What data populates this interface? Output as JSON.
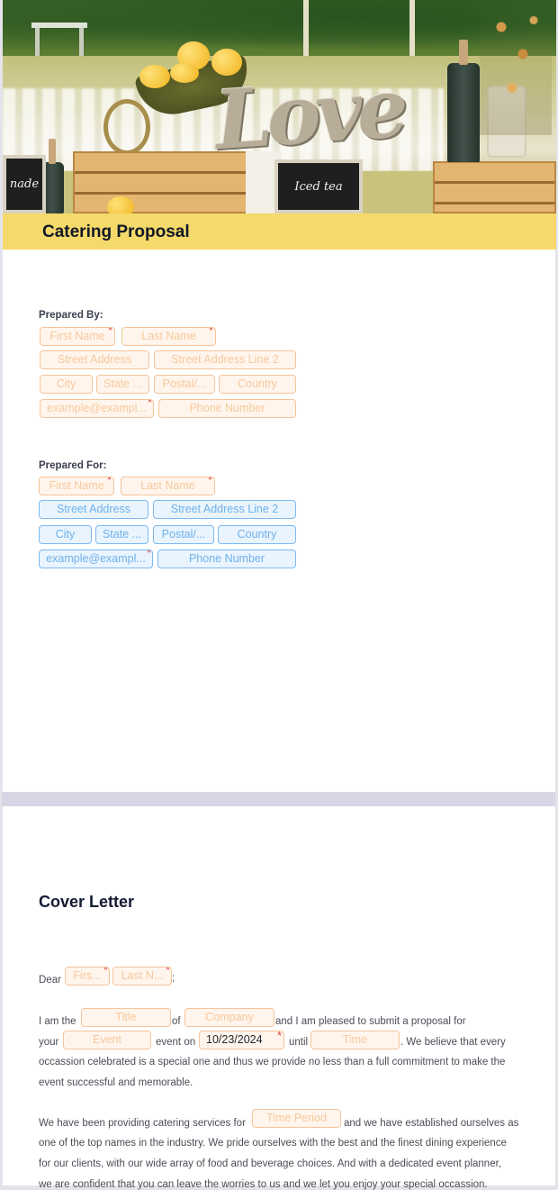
{
  "document": {
    "title": "Catering Proposal",
    "theme_color": "#f5d96a"
  },
  "hero": {
    "chalkboard_left": "nade",
    "chalkboard_center": "Iced tea",
    "sign": "Love"
  },
  "prepared_by": {
    "label": "Prepared By:",
    "first_name": {
      "placeholder": "First Name",
      "required": true
    },
    "last_name": {
      "placeholder": "Last Name",
      "required": true
    },
    "street_address": {
      "placeholder": "Street Address"
    },
    "street_address_2": {
      "placeholder": "Street Address Line 2"
    },
    "city": {
      "placeholder": "City"
    },
    "state": {
      "placeholder": "State ..."
    },
    "postal": {
      "placeholder": "Postal/..."
    },
    "country": {
      "placeholder": "Country"
    },
    "email": {
      "placeholder": "example@exampl...",
      "required": true
    },
    "phone": {
      "placeholder": "Phone Number"
    }
  },
  "prepared_for": {
    "label": "Prepared For:",
    "first_name": {
      "placeholder": "First Name",
      "required": true
    },
    "last_name": {
      "placeholder": "Last Name",
      "required": true
    },
    "street_address": {
      "placeholder": "Street Address"
    },
    "street_address_2": {
      "placeholder": "Street Address Line 2"
    },
    "city": {
      "placeholder": "City"
    },
    "state": {
      "placeholder": "State ..."
    },
    "postal": {
      "placeholder": "Postal/..."
    },
    "country": {
      "placeholder": "Country"
    },
    "email": {
      "placeholder": "example@exampl...",
      "required": true
    },
    "phone": {
      "placeholder": "Phone Number"
    }
  },
  "cover_letter": {
    "title": "Cover Letter",
    "dear": "Dear",
    "dear_first": {
      "placeholder": "Firs...",
      "required": true
    },
    "dear_last": {
      "placeholder": "Last N...",
      "required": true
    },
    "dear_end": ";",
    "p1": {
      "t1": "I am the",
      "title_field": "Title",
      "t2": "of",
      "company_field": "Company",
      "t3": "and I am pleased to submit a proposal for",
      "t4": "your",
      "event_field": "Event",
      "t5": "event on",
      "date_value": "10/23/2024",
      "t6": "until",
      "time_field": "Time",
      "t7": ".  We believe that every",
      "line3": "occassion celebrated is a special one and thus we provide no less than a full commitment to make the",
      "line4": "event successful and memorable."
    },
    "p2": {
      "t1": "We have been providing catering services for",
      "period_field": "Time Period",
      "t2": "and we have established ourselves as",
      "line2": "one of the top names in the industry.  We pride ourselves with the best and the finest dining experience",
      "line3": "for our clients, with our wide array of food and beverage choices. And with a dedicated event planner,",
      "line4": "we are confident that you can leave the worries to us and we let you enjoy your special occassion."
    }
  },
  "required_marker": "*"
}
